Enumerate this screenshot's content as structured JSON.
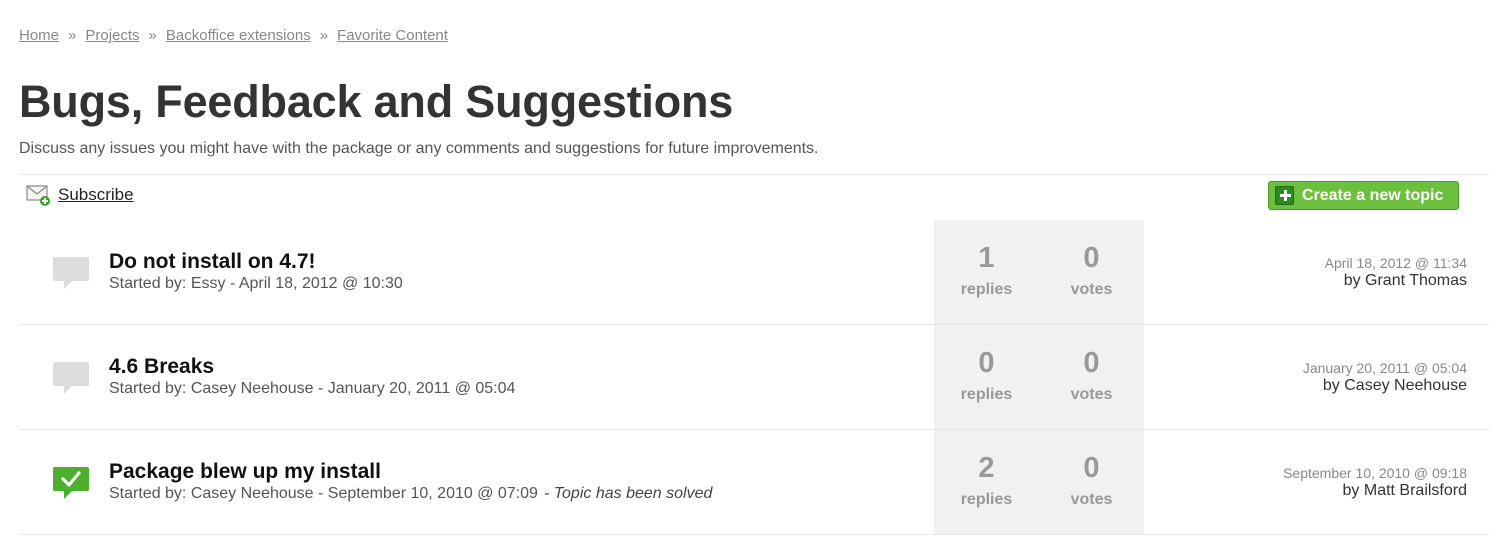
{
  "breadcrumb": {
    "items": [
      "Home",
      "Projects",
      "Backoffice extensions",
      "Favorite Content"
    ],
    "separator": "»"
  },
  "page": {
    "title": "Bugs, Feedback and Suggestions",
    "description": "Discuss any issues you might have with the package or any comments and suggestions for future improvements."
  },
  "toolbar": {
    "subscribe_label": "Subscribe",
    "subscribe_icon": "mail-add-icon",
    "create_label": "Create a new topic",
    "create_icon": "plus-icon",
    "accent_color": "#6cbf3f"
  },
  "topics": [
    {
      "title": "Do not install on 4.7!",
      "started": "Started by: Essy - April 18, 2012 @ 10:30",
      "solved_note": "",
      "icon": "speech-bubble-icon",
      "replies": "1",
      "replies_label": "replies",
      "votes": "0",
      "votes_label": "votes",
      "last_date": "April 18, 2012 @ 11:34",
      "last_by": "by Grant Thomas"
    },
    {
      "title": "4.6 Breaks",
      "started": "Started by: Casey Neehouse - January 20, 2011 @ 05:04",
      "solved_note": "",
      "icon": "speech-bubble-icon",
      "replies": "0",
      "replies_label": "replies",
      "votes": "0",
      "votes_label": "votes",
      "last_date": "January 20, 2011 @ 05:04",
      "last_by": "by Casey Neehouse"
    },
    {
      "title": "Package blew up my install",
      "started": "Started by: Casey Neehouse - September 10, 2010 @ 07:09",
      "solved_note": "- Topic has been solved",
      "icon": "solved-check-bubble-icon",
      "replies": "2",
      "replies_label": "replies",
      "votes": "0",
      "votes_label": "votes",
      "last_date": "September 10, 2010 @ 09:18",
      "last_by": "by Matt Brailsford"
    }
  ]
}
